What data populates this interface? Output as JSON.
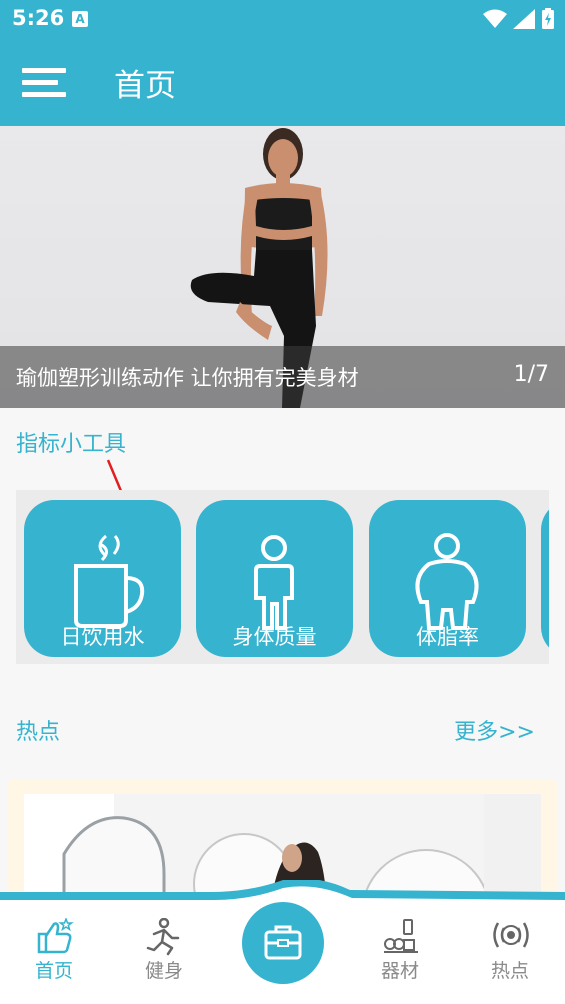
{
  "status_bar": {
    "time": "5:26",
    "notification_badge": "A"
  },
  "app_bar": {
    "title": "首页"
  },
  "banner": {
    "caption": "瑜伽塑形训练动作 让你拥有完美身材",
    "pager": "1/7"
  },
  "tools_section": {
    "title": "指标小工具",
    "tools": [
      {
        "label": "日饮用水",
        "icon": "cup-icon"
      },
      {
        "label": "身体质量",
        "icon": "person-icon"
      },
      {
        "label": "体脂率",
        "icon": "body-fat-icon"
      }
    ]
  },
  "hot_section": {
    "title": "热点",
    "more": "更多>>"
  },
  "bottom_nav": {
    "items": [
      {
        "label": "首页",
        "icon": "thumbs-up-icon",
        "active": true
      },
      {
        "label": "健身",
        "icon": "runner-icon",
        "active": false
      },
      {
        "label": "器材",
        "icon": "equipment-icon",
        "active": false
      },
      {
        "label": "热点",
        "icon": "broadcast-icon",
        "active": false
      }
    ],
    "center_icon": "toolbox-icon"
  },
  "colors": {
    "primary": "#35b3cf",
    "inactive": "#8a8a8a",
    "annotation_arrow": "#e02020"
  }
}
